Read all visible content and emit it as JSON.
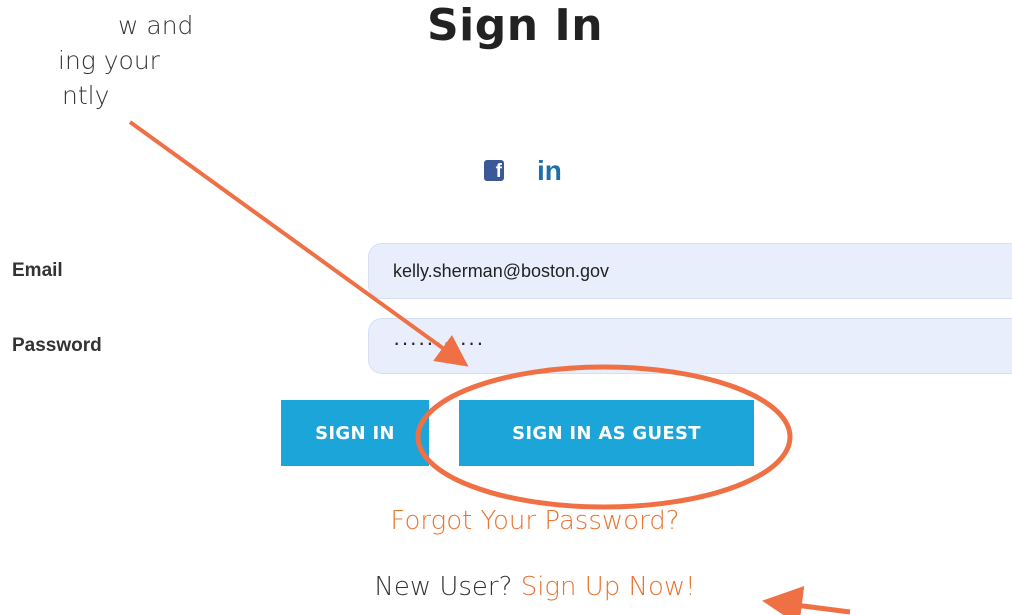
{
  "annotation": {
    "lines": [
      "w and",
      "ing your",
      "ntly"
    ]
  },
  "page_title": "Sign In",
  "social": {
    "facebook_glyph": "f",
    "facebook_icon": "facebook-icon",
    "linkedin_glyph": "in",
    "linkedin_icon": "linkedin-icon"
  },
  "form": {
    "email_label": "Email",
    "email_value": "kelly.sherman@boston.gov",
    "password_label": "Password",
    "password_value": "···········"
  },
  "buttons": {
    "sign_in": "SIGN IN",
    "sign_in_guest": "SIGN IN AS GUEST"
  },
  "links": {
    "forgot_password": "Forgot Your Password?",
    "new_user_prefix": "New User? ",
    "sign_up": "Sign Up Now!"
  },
  "colors": {
    "button_bg": "#1ba5d8",
    "input_bg": "#e8eefb",
    "link_orange": "#e8742f",
    "annotation_orange": "#f07045",
    "facebook_blue": "#3b5998",
    "linkedin_blue": "#1d6fa8"
  }
}
